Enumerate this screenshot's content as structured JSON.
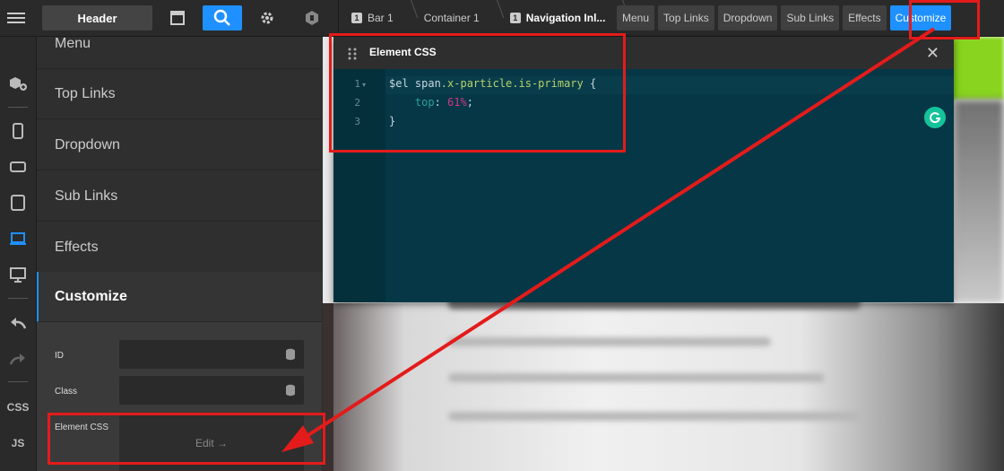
{
  "topbar": {
    "header_label": "Header",
    "breadcrumbs": [
      {
        "num": "1",
        "label": "Bar 1"
      },
      {
        "num": "",
        "label": "Container 1"
      },
      {
        "num": "1",
        "label": "Navigation Inl..."
      }
    ],
    "tabs": [
      "Menu",
      "Top Links",
      "Dropdown",
      "Sub Links",
      "Effects",
      "Customize"
    ],
    "active_tab": "Customize",
    "accent_color": "#1e90ff"
  },
  "rail": {
    "css_label": "CSS",
    "js_label": "JS"
  },
  "panel": {
    "menu_items": [
      "Menu",
      "Top Links",
      "Dropdown",
      "Sub Links",
      "Effects",
      "Customize"
    ],
    "active_item": "Customize",
    "form": {
      "id_label": "ID",
      "class_label": "Class",
      "element_css_label": "Element CSS",
      "edit_label": "Edit →"
    }
  },
  "modal": {
    "title": "Element CSS",
    "line_numbers": [
      "1",
      "2",
      "3"
    ],
    "code": {
      "line1_prefix": "$el span",
      "line1_selector": ".x-particle.is-primary",
      "line1_suffix": " {",
      "line2_prop": "top",
      "line2_value": "61%",
      "line3": "}"
    }
  },
  "annotation_color": "#e41b1b"
}
